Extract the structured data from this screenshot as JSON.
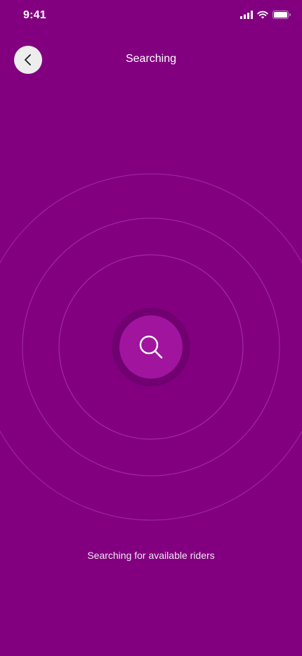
{
  "status_bar": {
    "time": "9:41",
    "icons": [
      "cellular-signal-icon",
      "wifi-icon",
      "battery-icon"
    ]
  },
  "header": {
    "title": "Searching",
    "back_icon": "chevron-left-icon"
  },
  "search": {
    "icon": "search-icon",
    "message": "Searching for available riders"
  },
  "colors": {
    "background": "#820080",
    "search_button": "#a0149e",
    "back_button": "#ededed"
  }
}
